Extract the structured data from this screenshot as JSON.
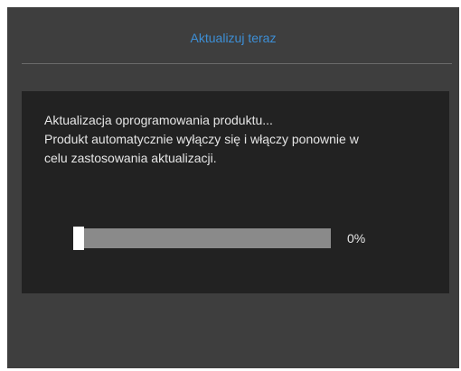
{
  "header": {
    "title": "Aktualizuj teraz"
  },
  "dialog": {
    "lines": [
      "Aktualizacja oprogramowania produktu...",
      "Produkt automatycznie wyłączy się i włączy ponownie w",
      "celu zastosowania aktualizacji."
    ],
    "progress": {
      "value": 0,
      "label": "0%"
    }
  },
  "colors": {
    "title": "#3d8fd6",
    "background": "#3e3e3e",
    "panel": "#222222",
    "track": "#8a8a8a",
    "handle": "#ffffff"
  }
}
